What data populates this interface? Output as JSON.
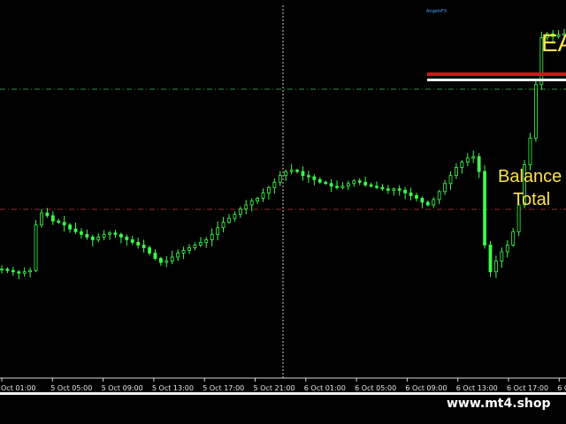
{
  "chart_data": {
    "type": "candlestick",
    "x_ticks": [
      "Oct 01:00",
      "5 Oct 05:00",
      "5 Oct 09:00",
      "5 Oct 13:00",
      "5 Oct 17:00",
      "5 Oct 21:00",
      "6 Oct 01:00",
      "6 Oct 05:00",
      "6 Oct 09:00",
      "6 Oct 13:00",
      "6 Oct 17:00",
      "6 Oct"
    ],
    "series": [
      {
        "values": [
          0.22,
          0.21,
          0.2,
          0.19,
          0.2,
          0.21,
          0.55,
          0.64,
          0.62,
          0.58,
          0.57,
          0.55,
          0.52,
          0.5,
          0.48,
          0.46,
          0.44,
          0.46,
          0.48,
          0.49,
          0.48,
          0.46,
          0.44,
          0.42,
          0.4,
          0.38,
          0.34,
          0.3,
          0.27,
          0.28,
          0.31,
          0.34,
          0.36,
          0.38,
          0.4,
          0.42,
          0.44,
          0.48,
          0.53,
          0.57,
          0.6,
          0.63,
          0.67,
          0.7,
          0.73,
          0.75,
          0.79,
          0.83,
          0.87,
          0.92,
          0.95,
          0.96,
          0.95,
          0.92,
          0.91,
          0.89,
          0.87,
          0.86,
          0.84,
          0.83,
          0.84,
          0.86,
          0.88,
          0.87,
          0.85,
          0.84,
          0.83,
          0.82,
          0.81,
          0.82,
          0.81,
          0.79,
          0.77,
          0.75,
          0.72,
          0.7,
          0.74,
          0.8,
          0.86,
          0.92,
          0.98,
          1.02,
          1.05,
          1.06,
          0.95,
          0.4,
          0.2,
          0.28,
          0.35,
          0.4,
          0.5,
          0.7,
          1.0,
          1.2,
          1.6,
          1.95,
          1.98,
          1.96,
          1.97,
          1.98
        ]
      }
    ],
    "ylim": [
      0.0,
      2.1
    ],
    "grid": false,
    "overlay_text": {
      "ea": "EA",
      "balance": "Balance",
      "total": "Total"
    },
    "watermark": {
      "top": "AngelsFX",
      "brand": "www.mt4.shop"
    },
    "colors": {
      "background": "#000000",
      "candles": "#39ff4a",
      "text": "#ffe24a",
      "white_line": "#ffffff",
      "red_line": "#d01818",
      "green_dash": "#2f8f3f",
      "red_dash": "#9b2a2a"
    }
  }
}
